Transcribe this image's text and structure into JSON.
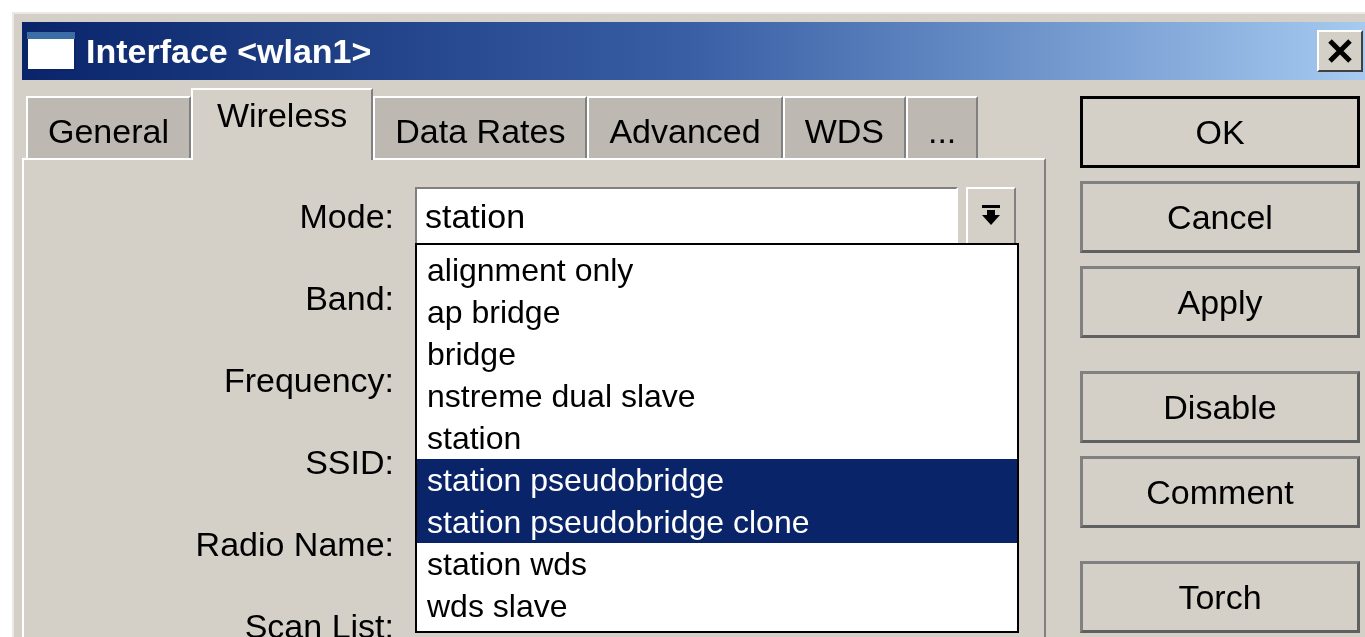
{
  "window": {
    "title": "Interface <wlan1>"
  },
  "tabs": [
    {
      "label": "General",
      "selected": false
    },
    {
      "label": "Wireless",
      "selected": true
    },
    {
      "label": "Data Rates",
      "selected": false
    },
    {
      "label": "Advanced",
      "selected": false
    },
    {
      "label": "WDS",
      "selected": false
    },
    {
      "label": "...",
      "selected": false
    }
  ],
  "fields": [
    {
      "label": "Mode:",
      "value": "station"
    },
    {
      "label": "Band:"
    },
    {
      "label": "Frequency:"
    },
    {
      "label": "SSID:"
    },
    {
      "label": "Radio Name:"
    },
    {
      "label": "Scan List:"
    }
  ],
  "dropdown_options": [
    {
      "label": "alignment only",
      "selected": false
    },
    {
      "label": "ap bridge",
      "selected": false
    },
    {
      "label": "bridge",
      "selected": false
    },
    {
      "label": "nstreme dual slave",
      "selected": false
    },
    {
      "label": "station",
      "selected": false
    },
    {
      "label": "station pseudobridge",
      "selected": true
    },
    {
      "label": "station pseudobridge clone",
      "selected": true
    },
    {
      "label": "station wds",
      "selected": false
    },
    {
      "label": "wds slave",
      "selected": false
    }
  ],
  "button_groups": [
    [
      {
        "label": "OK",
        "default": true
      },
      {
        "label": "Cancel",
        "default": false
      },
      {
        "label": "Apply",
        "default": false
      }
    ],
    [
      {
        "label": "Disable",
        "default": false
      },
      {
        "label": "Comment",
        "default": false
      }
    ],
    [
      {
        "label": "Torch",
        "default": false
      }
    ]
  ]
}
